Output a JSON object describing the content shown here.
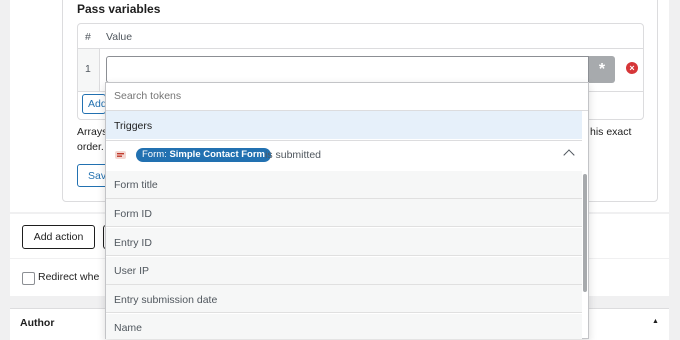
{
  "section": {
    "title": "Pass variables"
  },
  "table": {
    "col_hash": "#",
    "col_value": "Value",
    "rows": [
      {
        "num": "1",
        "value": ""
      }
    ],
    "token_button": "*",
    "add_fragment": "Add"
  },
  "help": {
    "line1_fragment": "Arrays",
    "line1_end": "his exact",
    "line2_fragment": "order."
  },
  "save_fragment": "Sav",
  "actions": {
    "add_action_label": "Add action"
  },
  "redirect": {
    "label_fragment": "Redirect whe"
  },
  "author": {
    "label": "Author",
    "arrow": "▲"
  },
  "dropdown": {
    "search_placeholder": "Search tokens",
    "group_label": "Triggers",
    "trigger": {
      "badge_prefix": "Form:",
      "badge_name": "Simple Contact Form",
      "suffix": "is submitted"
    },
    "options": [
      "Form title",
      "Form ID",
      "Entry ID",
      "User IP",
      "Entry submission date",
      "Name"
    ]
  },
  "colors": {
    "accent": "#2271b1",
    "remove": "#d63638",
    "highlight": "#e6f0fa"
  }
}
